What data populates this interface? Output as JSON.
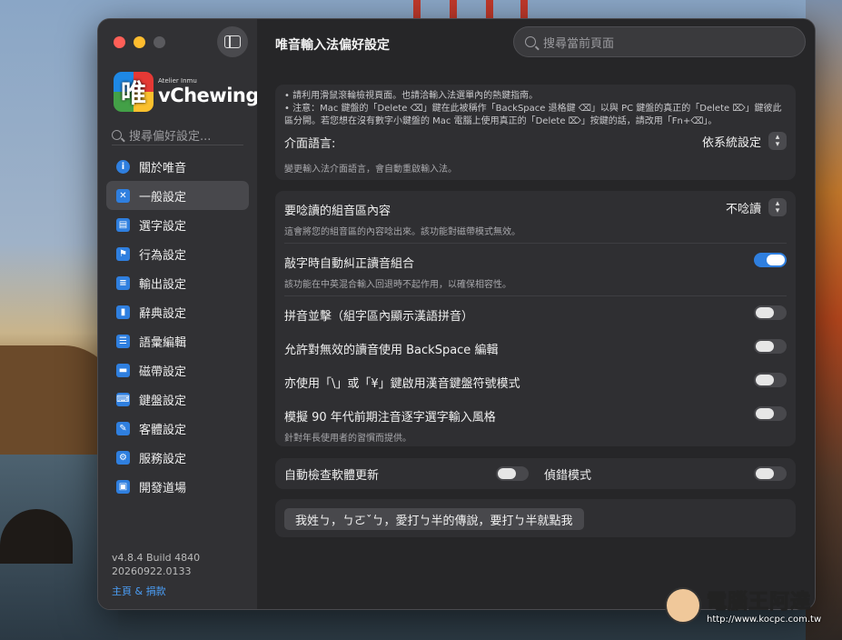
{
  "window": {
    "title": "唯音輸入法偏好設定"
  },
  "search": {
    "placeholder": "搜尋當前頁面"
  },
  "sidebar": {
    "brand_small": "Atelier Inmu",
    "brand": "vChewing",
    "logo_char": "唯",
    "search_placeholder": "搜尋偏好設定...",
    "items": [
      {
        "label": "關於唯音",
        "icon": "info-icon"
      },
      {
        "label": "一般設定",
        "icon": "tools-icon"
      },
      {
        "label": "選字設定",
        "icon": "candidate-icon"
      },
      {
        "label": "行為設定",
        "icon": "behavior-icon"
      },
      {
        "label": "輸出設定",
        "icon": "output-icon"
      },
      {
        "label": "辭典設定",
        "icon": "book-icon"
      },
      {
        "label": "語彙編輯",
        "icon": "edit-list-icon"
      },
      {
        "label": "磁帶設定",
        "icon": "cassette-icon"
      },
      {
        "label": "鍵盤設定",
        "icon": "keyboard-icon"
      },
      {
        "label": "客體設定",
        "icon": "client-icon"
      },
      {
        "label": "服務設定",
        "icon": "gear-icon"
      },
      {
        "label": "開發道場",
        "icon": "dev-icon"
      }
    ],
    "active_index": 1,
    "version": "v4.8.4 Build 4840",
    "build_date": "20260922.0133",
    "home_link": "主頁 & 捐款"
  },
  "notes": {
    "line1": "• 請利用滑鼠滾輪檢視頁面。也請洽輸入法選單內的熱鍵指南。",
    "line2": "• 注意：Mac 鍵盤的「Delete ⌫」鍵在此被稱作「BackSpace 退格鍵 ⌫」以與 PC 鍵盤的真正的「Delete ⌦」鍵彼此區分開。若您想在沒有數字小鍵盤的 Mac 電腦上使用真正的「Delete ⌦」按鍵的話，請改用「Fn+⌫」。"
  },
  "interface_language": {
    "label": "介面語言:",
    "value": "依系統設定",
    "desc": "變更輸入法介面語言，會自動重啟輸入法。"
  },
  "readout": {
    "label": "要唸讀的組音區內容",
    "value": "不唸讀",
    "desc": "這會將您的組音區的內容唸出來。該功能對磁帶模式無效。"
  },
  "toggles": [
    {
      "label": "敲字時自動糾正讀音組合",
      "desc": "該功能在中英混合輸入回退時不起作用，以確保相容性。",
      "on": true
    },
    {
      "label": "拼音並擊（組字區內顯示漢語拼音）",
      "desc": "",
      "on": false
    },
    {
      "label": "允許對無效的讀音使用 BackSpace 編輯",
      "desc": "",
      "on": false
    },
    {
      "label": "亦使用「\\」或「¥」鍵啟用漢音鍵盤符號模式",
      "desc": "",
      "on": false
    },
    {
      "label": "模擬 90 年代前期注音逐字選字輸入風格",
      "desc": "針對年長使用者的習慣而提供。",
      "on": false
    }
  ],
  "bottom_toggles": {
    "auto_update": {
      "label": "自動檢查軟體更新",
      "on": false
    },
    "debug": {
      "label": "偵錯模式",
      "on": false
    }
  },
  "tip_button": {
    "label": "我姓ㄅ，ㄅㄛˇㄅ，愛打ㄅ半的傳說，要打ㄅ半就點我"
  },
  "watermark": {
    "title": "電腦王阿達",
    "url": "http://www.kocpc.com.tw"
  }
}
